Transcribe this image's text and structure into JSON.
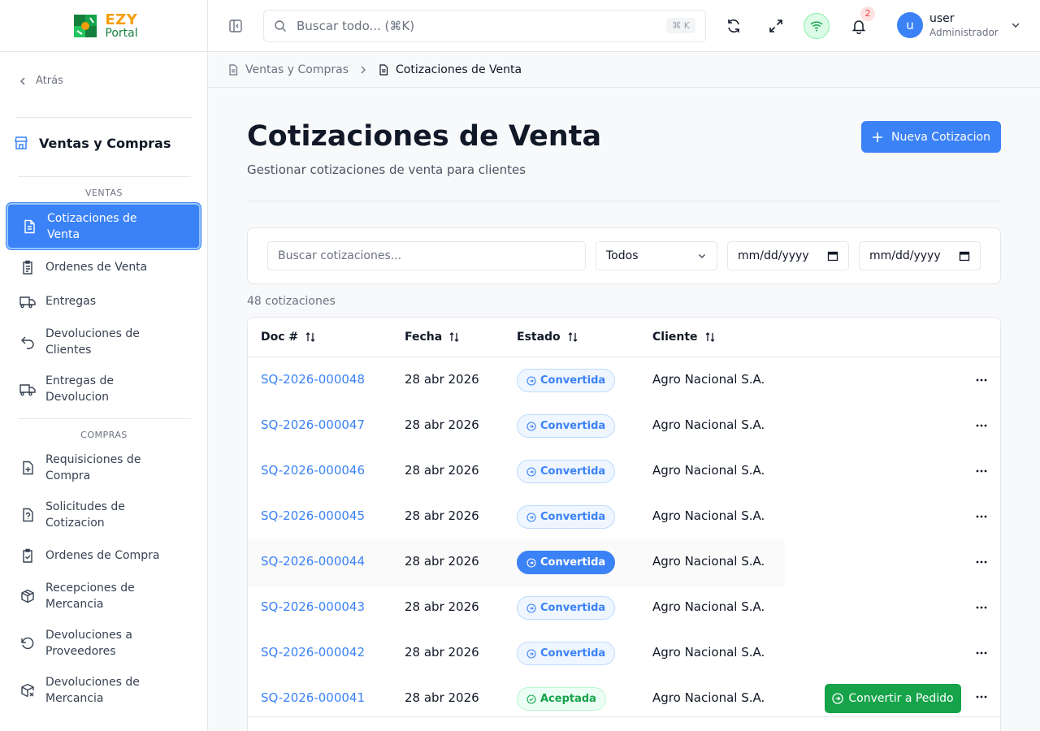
{
  "brand": {
    "line1": "EZY",
    "line2": "Portal"
  },
  "sidebar": {
    "back_label": "Atrás",
    "module_title": "Ventas y Compras",
    "sections": [
      {
        "label": "VENTAS"
      },
      {
        "label": "COMPRAS"
      }
    ],
    "items": [
      {
        "l1": "Cotizaciones de",
        "l2": "Venta",
        "icon": "file-text-icon"
      },
      {
        "l1": "Ordenes de Venta",
        "l2": "",
        "icon": "clipboard-list-icon"
      },
      {
        "l1": "Entregas",
        "l2": "",
        "icon": "truck-icon"
      },
      {
        "l1": "Devoluciones de",
        "l2": "Clientes",
        "icon": "undo-icon"
      },
      {
        "l1": "Entregas de",
        "l2": "Devolucion",
        "icon": "truck-icon"
      },
      {
        "l1": "Requisiciones de",
        "l2": "Compra",
        "icon": "file-plus-icon"
      },
      {
        "l1": "Solicitudes de",
        "l2": "Cotizacion",
        "icon": "file-question-icon"
      },
      {
        "l1": "Ordenes de Compra",
        "l2": "",
        "icon": "clipboard-check-icon"
      },
      {
        "l1": "Recepciones de",
        "l2": "Mercancia",
        "icon": "package-icon"
      },
      {
        "l1": "Devoluciones a",
        "l2": "Proveedores",
        "icon": "rotate-ccw-icon"
      },
      {
        "l1": "Devoluciones de",
        "l2": "Mercancia",
        "icon": "package-x-icon"
      }
    ]
  },
  "header": {
    "search_placeholder": "Buscar todo... (⌘K)",
    "shortcut": "⌘ K",
    "notifications_count": "2",
    "user_name": "user",
    "user_role": "Administrador",
    "avatar_letter": "u"
  },
  "breadcrumb": {
    "parent": "Ventas y Compras",
    "current": "Cotizaciones de Venta"
  },
  "page": {
    "title": "Cotizaciones de Venta",
    "subtitle": "Gestionar cotizaciones de venta para clientes",
    "new_button": "Nueva Cotizacion"
  },
  "filters": {
    "search_placeholder": "Buscar cotizaciones...",
    "status_value": "Todos",
    "date_from": "mm/dd/yyyy",
    "date_to": "mm/dd/yyyy"
  },
  "count_label": "48 cotizaciones",
  "table": {
    "columns": [
      "Doc #",
      "Fecha",
      "Estado",
      "Cliente"
    ],
    "rows": [
      {
        "doc": "SQ-2026-000048",
        "date": "28 abr 2026",
        "status": "Convertida",
        "client": "Agro Nacional S.A."
      },
      {
        "doc": "SQ-2026-000047",
        "date": "28 abr 2026",
        "status": "Convertida",
        "client": "Agro Nacional S.A."
      },
      {
        "doc": "SQ-2026-000046",
        "date": "28 abr 2026",
        "status": "Convertida",
        "client": "Agro Nacional S.A."
      },
      {
        "doc": "SQ-2026-000045",
        "date": "28 abr 2026",
        "status": "Convertida",
        "client": "Agro Nacional S.A."
      },
      {
        "doc": "SQ-2026-000044",
        "date": "28 abr 2026",
        "status": "Convertida",
        "client": "Agro Nacional S.A."
      },
      {
        "doc": "SQ-2026-000043",
        "date": "28 abr 2026",
        "status": "Convertida",
        "client": "Agro Nacional S.A."
      },
      {
        "doc": "SQ-2026-000042",
        "date": "28 abr 2026",
        "status": "Convertida",
        "client": "Agro Nacional S.A."
      },
      {
        "doc": "SQ-2026-000041",
        "date": "28 abr 2026",
        "status": "Aceptada",
        "client": "Agro Nacional S.A.",
        "action": "Convertir a Pedido"
      }
    ]
  },
  "colors": {
    "accent": "#3b82f6",
    "success": "#16a34a",
    "brand_orange": "#f59e0b",
    "brand_green": "#15803d"
  }
}
